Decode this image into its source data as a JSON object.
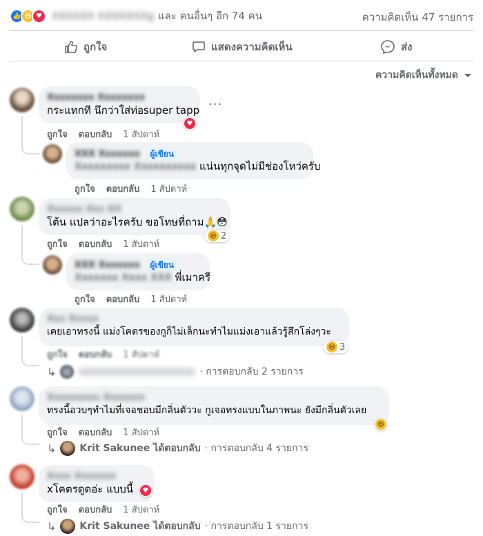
{
  "summary": {
    "others_text": "และ คนอื่นๆ อีก 74 คน",
    "blurred_name": "XXXXXX XXXXXXXg",
    "comment_count": "ความคิดเห็น 47 รายการ"
  },
  "actions": {
    "like": "ถูกใจ",
    "comment": "แสดงความคิดเห็น",
    "share": "ส่ง"
  },
  "filter": {
    "label": "ความคิดเห็นทั้งหมด"
  },
  "meta": {
    "like": "ถูกใจ",
    "reply": "ตอบกลับ",
    "time": "1 สัปดาห์"
  },
  "author_badge": "ผู้เขียน",
  "comments": [
    {
      "name": "Xxxxxxxx Xxxxxxxx",
      "text": "กระแทกที นึกว่าใส่ท่อsuper tapp"
    },
    {
      "name": "XXX Xxxxxxx",
      "text_blur": "Xxxxxxxxx Xxxxxxxxxx",
      "text": "แน่นทุกจุดไม่มีช่องโหว่ครับ"
    },
    {
      "name": "Xxxxxx Xxx XX",
      "text": "โต้น แปลว่าอะไรครับ ขอโทษที่ถาม🙏😳",
      "react_count": "2"
    },
    {
      "name": "XXX Xxxxxxx",
      "text_blur": "Xxxxxxx Xxxx XXX",
      "text": "พี่เมาครี"
    },
    {
      "name": "Xxx Xxxxx",
      "text": "เคยเอาทรงนี้ แม่งโคตรของกูก็ไม่เล็กนะทำไมแม่งเอาแล้วรู้สึกโล่งๆวะ",
      "react_count": "3",
      "replies": "· การตอบกลับ 2 รายการ"
    },
    {
      "name": "Xxxxxxxxx Xxxxxxx",
      "text": "ทรงนี้อวบๆทำไมที่เจอชอบมีกลิ่นตัววะ กูเจอทรงแบบในภาพนะ ยังมีกลิ่นตัวเลย",
      "replier": "Krit Sakunee ได้ตอบกลับ",
      "replies": "· การตอบกลับ 4 รายการ"
    },
    {
      "name": "Xxxx Xxxxxxx",
      "text": "x︎โคตรดูดอ่ะ แบบนี้",
      "replier": "Krit Sakunee ได้ตอบกลับ",
      "replies": "· การตอบกลับ 1 รายการ"
    }
  ],
  "colors": {
    "accent": "#1877f2",
    "bubble": "#f0f2f5",
    "muted": "#65676b"
  }
}
